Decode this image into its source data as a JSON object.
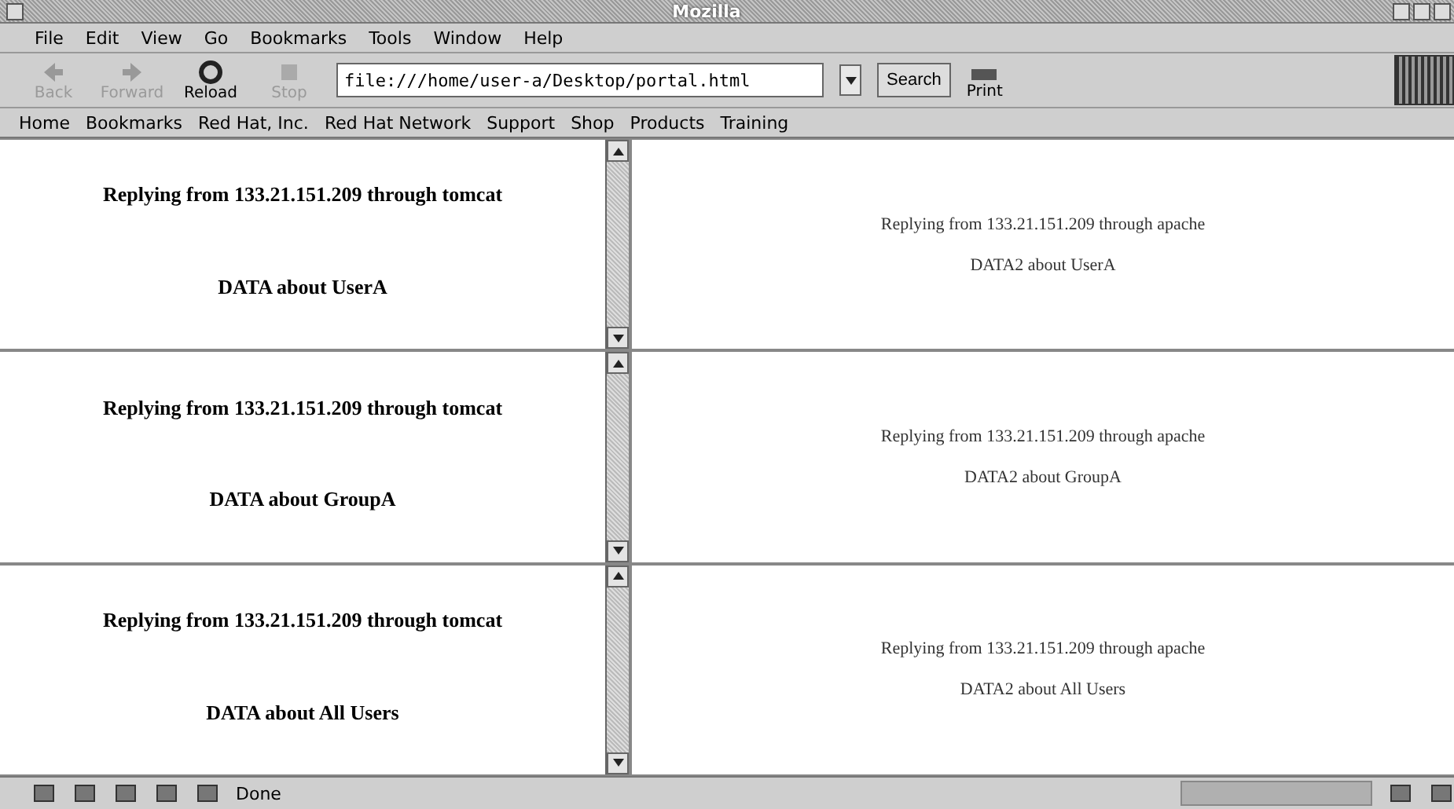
{
  "window": {
    "title": "Mozilla"
  },
  "menu": [
    "File",
    "Edit",
    "View",
    "Go",
    "Bookmarks",
    "Tools",
    "Window",
    "Help"
  ],
  "nav_buttons": [
    {
      "label": "Back",
      "disabled": true,
      "kind": "back"
    },
    {
      "label": "Forward",
      "disabled": true,
      "kind": "forward"
    },
    {
      "label": "Reload",
      "disabled": false,
      "kind": "reload"
    },
    {
      "label": "Stop",
      "disabled": true,
      "kind": "stop"
    }
  ],
  "url": "file:///home/user-a/Desktop/portal.html",
  "search_button": "Search",
  "print_button": "Print",
  "personal_bar": [
    "Home",
    "Bookmarks",
    "Red Hat, Inc.",
    "Red Hat Network",
    "Support",
    "Shop",
    "Products",
    "Training"
  ],
  "frames": [
    {
      "left": [
        "Replying from 133.21.151.209 through tomcat",
        "DATA about UserA"
      ],
      "right": [
        "Replying from 133.21.151.209 through apache",
        "DATA2 about UserA"
      ]
    },
    {
      "left": [
        "Replying from 133.21.151.209 through tomcat",
        "DATA about GroupA"
      ],
      "right": [
        "Replying from 133.21.151.209 through apache",
        "DATA2 about GroupA"
      ]
    },
    {
      "left": [
        "Replying from 133.21.151.209 through tomcat",
        "DATA about All Users"
      ],
      "right": [
        "Replying from 133.21.151.209 through apache",
        "DATA2 about All Users"
      ]
    }
  ],
  "status": "Done"
}
